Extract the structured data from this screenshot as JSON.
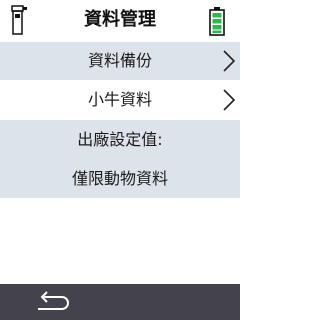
{
  "header": {
    "title": "資料管理",
    "left_icon": "device-icon",
    "right_icon": "battery-icon",
    "battery_color": "#2fb84a"
  },
  "menu": {
    "items": [
      {
        "label": "資料備份",
        "icon": "chevron-right-icon"
      },
      {
        "label": "小牛資料",
        "icon": "chevron-right-icon"
      }
    ]
  },
  "factory": {
    "line1": "出廠設定值:",
    "line2": "僅限動物資料"
  },
  "footer": {
    "icon": "back-icon"
  },
  "colors": {
    "row_shade": "#dde3ea",
    "footer_bg": "#44434d"
  }
}
